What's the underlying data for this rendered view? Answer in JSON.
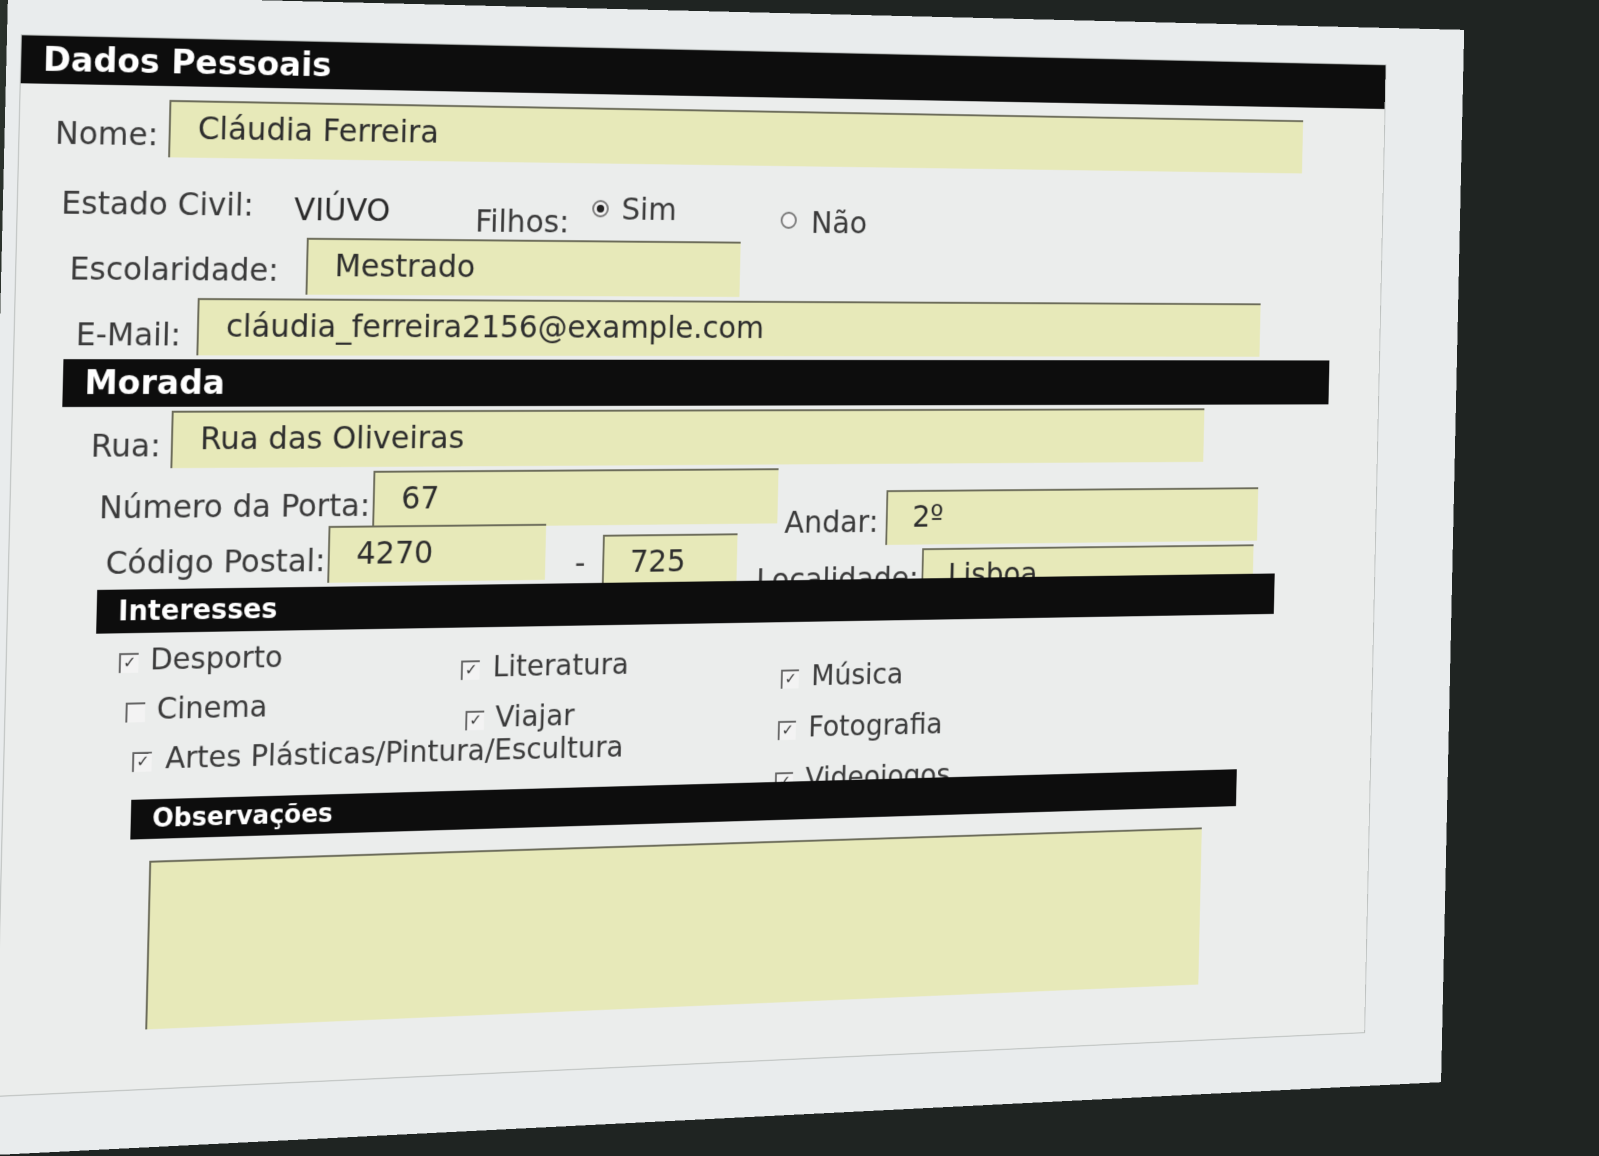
{
  "sections": {
    "personal": "Dados Pessoais",
    "address": "Morada",
    "interests": "Interesses",
    "notes": "Observações"
  },
  "personal": {
    "name_label": "Nome:",
    "name_value": "Cláudia Ferreira",
    "civil_label": "Estado Civil:",
    "civil_value": "VIÚVO",
    "children_label": "Filhos:",
    "children_options": [
      {
        "label": "Sim",
        "selected": true
      },
      {
        "label": "Não",
        "selected": false
      }
    ],
    "education_label": "Escolaridade:",
    "education_value": "Mestrado",
    "email_label": "E-Mail:",
    "email_value": "cláudia_ferreira2156@example.com"
  },
  "address": {
    "street_label": "Rua:",
    "street_value": "Rua das Oliveiras",
    "door_label": "Número da Porta:",
    "door_value": "67",
    "floor_label": "Andar:",
    "floor_value": "2º",
    "postal_label": "Código Postal:",
    "postal_part1": "4270",
    "postal_separator": "-",
    "postal_part2": "725",
    "locality_label": "Localidade:",
    "locality_value": "Lisboa"
  },
  "interests": [
    {
      "label": "Desporto",
      "checked": true
    },
    {
      "label": "Literatura",
      "checked": true
    },
    {
      "label": "Música",
      "checked": true
    },
    {
      "label": "Cinema",
      "checked": false
    },
    {
      "label": "Viajar",
      "checked": true
    },
    {
      "label": "Fotografia",
      "checked": true
    },
    {
      "label": "Artes Plásticas/Pintura/Escultura",
      "checked": true
    },
    {
      "label": "Videojogos",
      "checked": true
    }
  ],
  "notes": {
    "value": ""
  }
}
